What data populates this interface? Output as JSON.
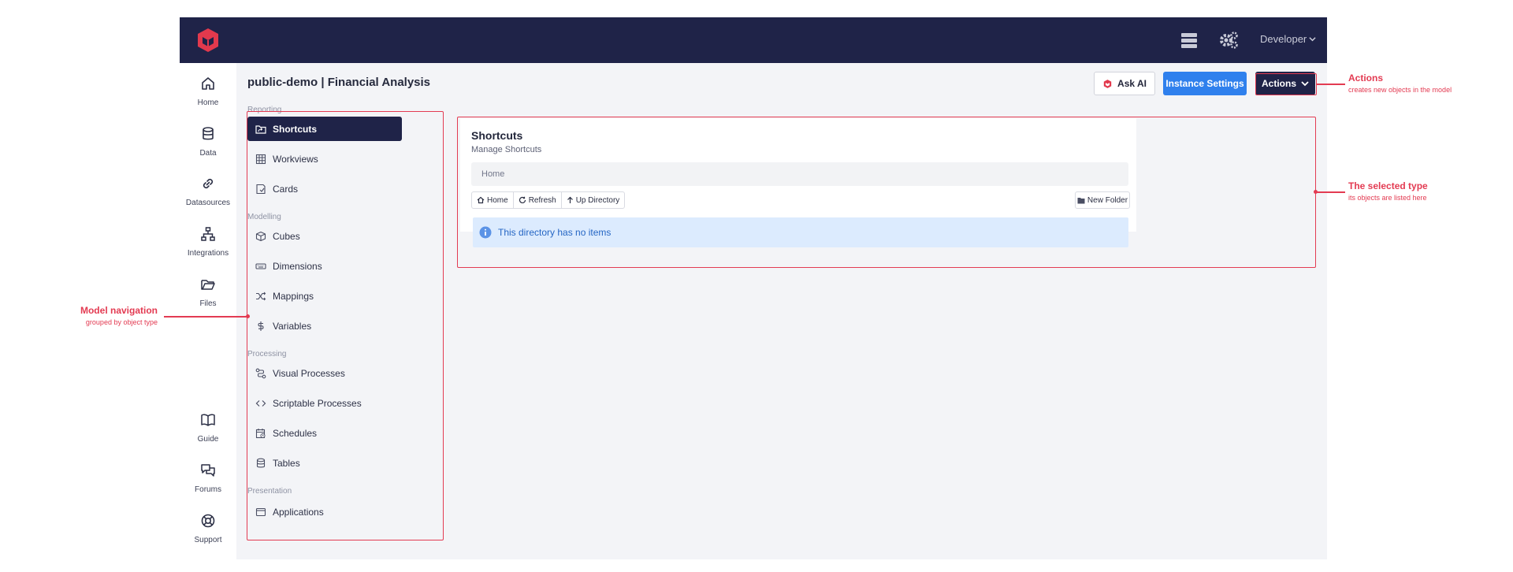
{
  "topbar": {
    "user_menu_label": "Developer",
    "icons": [
      "logo-icon",
      "server-icon",
      "gears-icon",
      "chevron-down-icon"
    ],
    "colors": {
      "bar": "#1f2348",
      "logo": "#e2394d"
    }
  },
  "rail": {
    "items": [
      {
        "label": "Home",
        "icon": "home-icon"
      },
      {
        "label": "Data",
        "icon": "database-icon"
      },
      {
        "label": "Datasources",
        "icon": "link-icon"
      },
      {
        "label": "Integrations",
        "icon": "network-icon"
      },
      {
        "label": "Files",
        "icon": "folder-open-icon"
      },
      {
        "label": "Guide",
        "icon": "book-icon"
      },
      {
        "label": "Forums",
        "icon": "chat-icon"
      },
      {
        "label": "Support",
        "icon": "lifebuoy-icon"
      }
    ]
  },
  "header": {
    "title": "public-demo | Financial Analysis",
    "ask_ai_label": "Ask AI",
    "instance_settings_label": "Instance Settings",
    "actions_label": "Actions",
    "colors": {
      "primary": "#2f80ed",
      "dark": "#1f2348"
    }
  },
  "nav": {
    "groups": [
      {
        "label": "Reporting"
      },
      {
        "label": "Modelling"
      },
      {
        "label": "Processing"
      },
      {
        "label": "Presentation"
      }
    ],
    "items": [
      {
        "label": "Shortcuts",
        "icon": "folder-shortcut-icon",
        "active": true
      },
      {
        "label": "Workviews",
        "icon": "table-icon"
      },
      {
        "label": "Cards",
        "icon": "card-icon"
      },
      {
        "label": "Cubes",
        "icon": "cube-icon"
      },
      {
        "label": "Dimensions",
        "icon": "keyboard-icon"
      },
      {
        "label": "Mappings",
        "icon": "shuffle-icon"
      },
      {
        "label": "Variables",
        "icon": "dollar-icon"
      },
      {
        "label": "Visual Processes",
        "icon": "route-icon"
      },
      {
        "label": "Scriptable Processes",
        "icon": "code-icon"
      },
      {
        "label": "Schedules",
        "icon": "calendar-clock-icon"
      },
      {
        "label": "Tables",
        "icon": "database-icon"
      },
      {
        "label": "Applications",
        "icon": "window-icon"
      }
    ]
  },
  "panel": {
    "title": "Shortcuts",
    "subtitle": "Manage Shortcuts",
    "breadcrumb": "Home",
    "toolbar": {
      "home_label": "Home",
      "refresh_label": "Refresh",
      "up_label": "Up Directory",
      "new_folder_label": "New Folder"
    },
    "info_message": "This directory has no items"
  },
  "annotations": {
    "actions": {
      "title": "Actions",
      "subtitle": "creates new objects in the model"
    },
    "selected_type": {
      "title": "The selected type",
      "subtitle": "its objects are listed here"
    },
    "model_navigation": {
      "title": "Model navigation",
      "subtitle": "grouped by object type"
    },
    "color": "#e33b52"
  }
}
